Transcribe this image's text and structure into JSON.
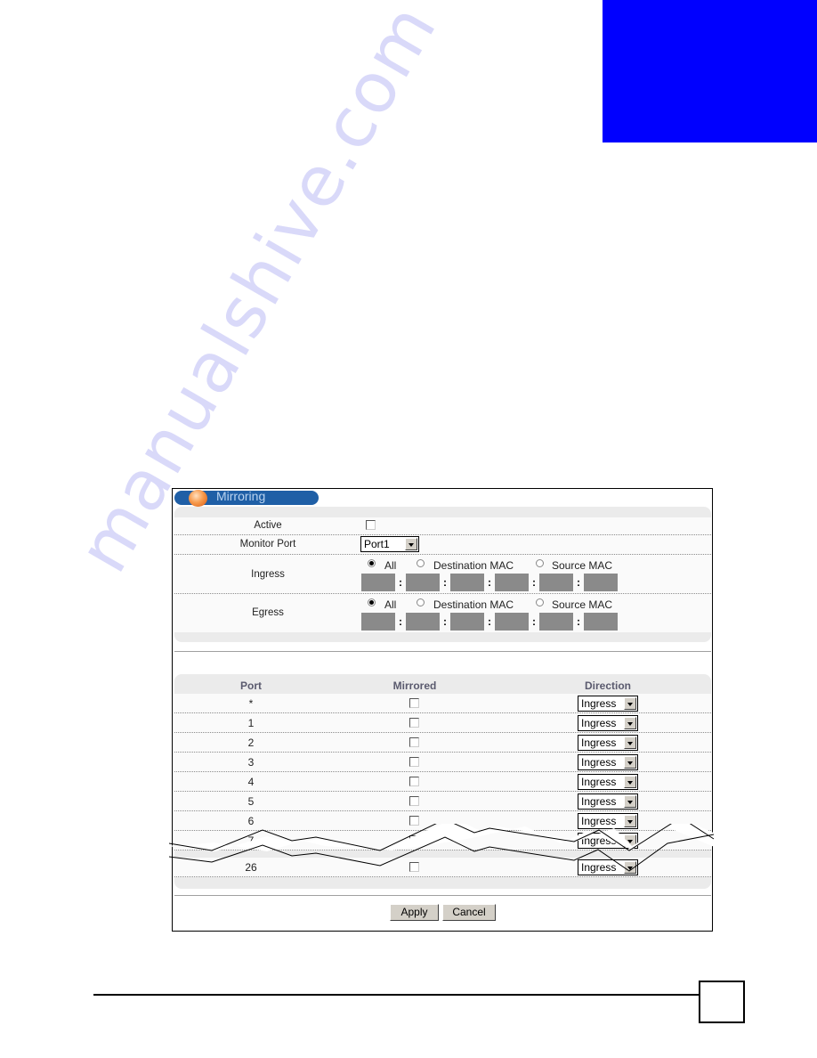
{
  "page": {
    "chapter_tab_color": "#0000ff",
    "watermark": "manualshive.com",
    "page_number": ""
  },
  "panel": {
    "title": "Mirroring",
    "active": {
      "label": "Active",
      "checked": false
    },
    "monitor_port": {
      "label": "Monitor Port",
      "value": "Port1"
    },
    "ingress": {
      "label": "Ingress",
      "options": [
        "All",
        "Destination MAC",
        "Source MAC"
      ],
      "selected": "All",
      "mac_fields": [
        "",
        "",
        "",
        "",
        "",
        ""
      ],
      "separator": ":"
    },
    "egress": {
      "label": "Egress",
      "options": [
        "All",
        "Destination MAC",
        "Source MAC"
      ],
      "selected": "All",
      "mac_fields": [
        "",
        "",
        "",
        "",
        "",
        ""
      ],
      "separator": ":"
    }
  },
  "table": {
    "headers": [
      "Port",
      "Mirrored",
      "Direction"
    ],
    "rows": [
      {
        "port": "*",
        "mirrored": false,
        "direction": "Ingress"
      },
      {
        "port": "1",
        "mirrored": false,
        "direction": "Ingress"
      },
      {
        "port": "2",
        "mirrored": false,
        "direction": "Ingress"
      },
      {
        "port": "3",
        "mirrored": false,
        "direction": "Ingress"
      },
      {
        "port": "4",
        "mirrored": false,
        "direction": "Ingress"
      },
      {
        "port": "5",
        "mirrored": false,
        "direction": "Ingress"
      },
      {
        "port": "6",
        "mirrored": false,
        "direction": "Ingress"
      },
      {
        "port": "7",
        "mirrored": false,
        "direction": "Ingress"
      },
      {
        "port": "26",
        "mirrored": false,
        "direction": "Ingress"
      }
    ]
  },
  "buttons": {
    "apply": "Apply",
    "cancel": "Cancel"
  }
}
